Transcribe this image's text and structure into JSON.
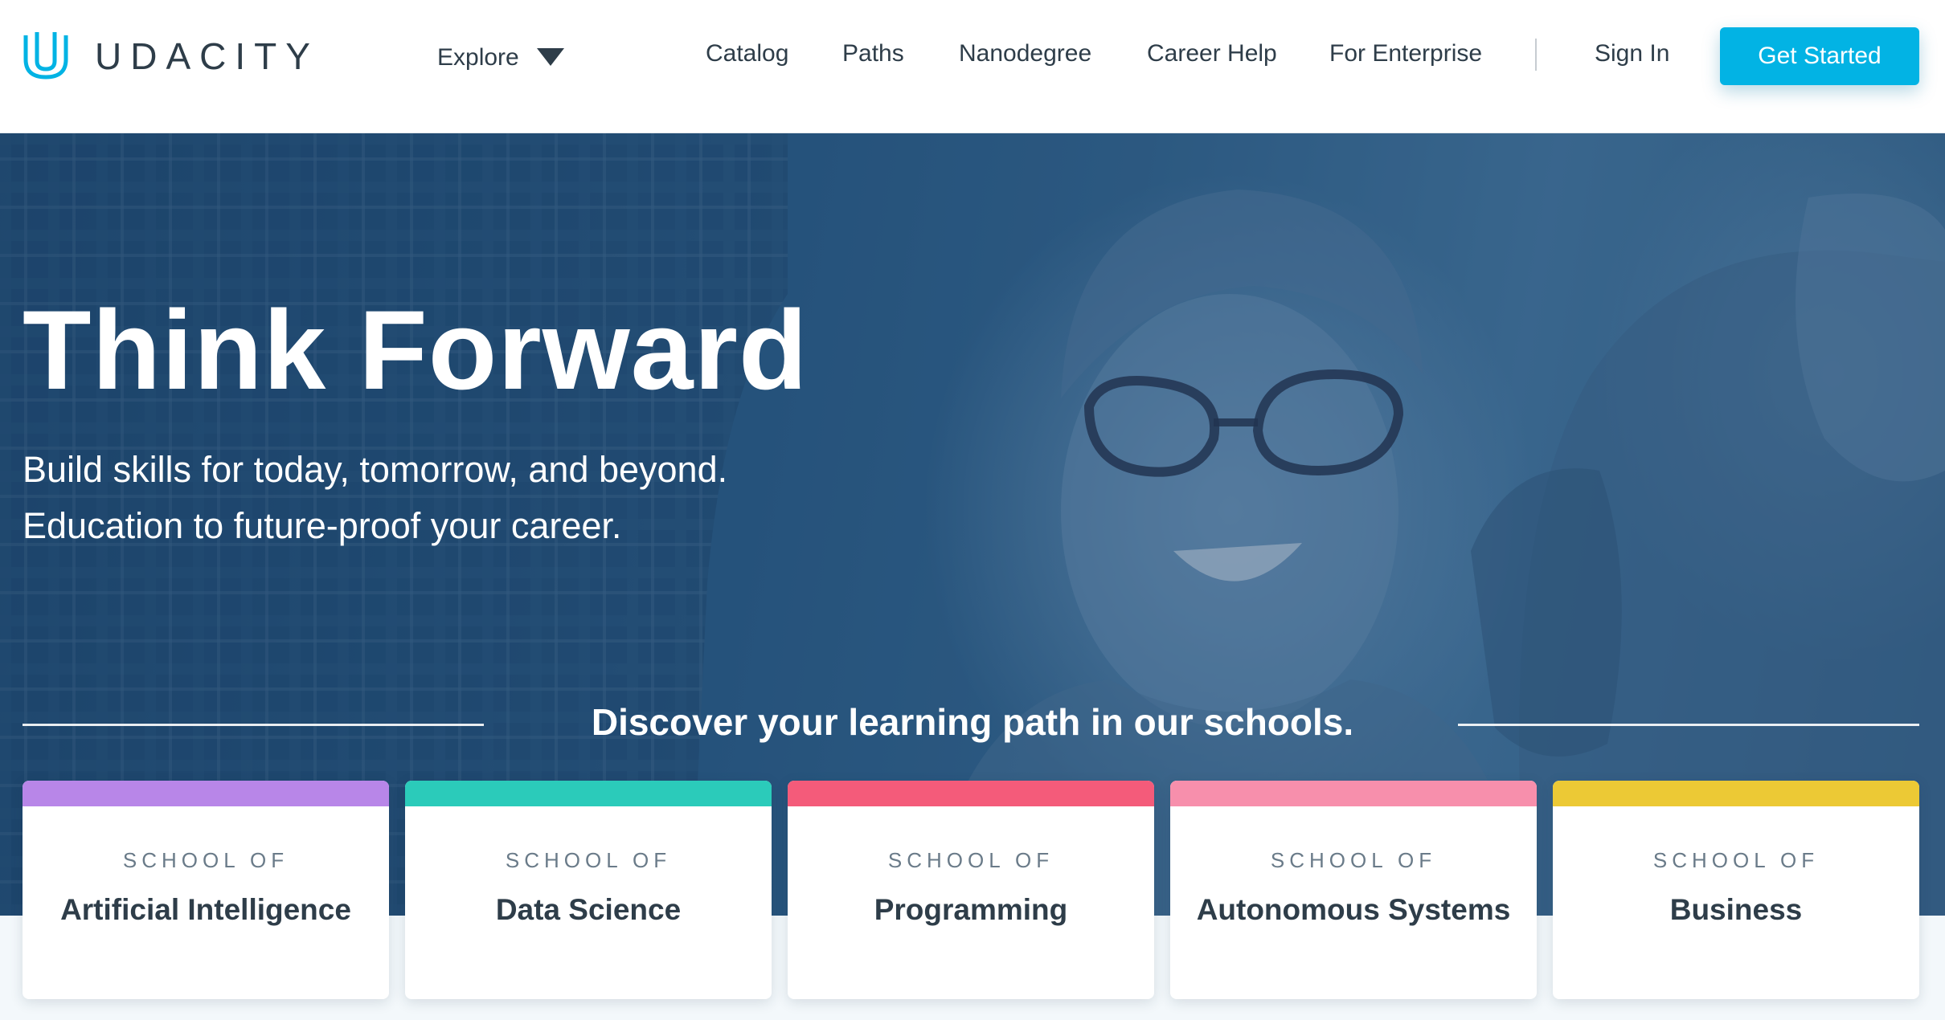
{
  "brand": {
    "name": "UDACITY",
    "accent": "#02b3e4"
  },
  "nav": {
    "explore_label": "Explore",
    "links": [
      "Catalog",
      "Paths",
      "Nanodegree",
      "Career Help",
      "For Enterprise"
    ],
    "signin_label": "Sign In",
    "cta_label": "Get Started"
  },
  "hero": {
    "headline": "Think Forward",
    "sub_line1": "Build skills for today, tomorrow, and beyond.",
    "sub_line2": "Education to future-proof your career.",
    "discover": "Discover your learning path in our schools."
  },
  "schools": [
    {
      "kicker": "SCHOOL OF",
      "title": "Artificial Intelligence",
      "color": "#b886e8"
    },
    {
      "kicker": "SCHOOL OF",
      "title": "Data Science",
      "color": "#2bcbba"
    },
    {
      "kicker": "SCHOOL OF",
      "title": "Programming",
      "color": "#f45b7a"
    },
    {
      "kicker": "SCHOOL OF",
      "title": "Autonomous Systems",
      "color": "#f78fac"
    },
    {
      "kicker": "SCHOOL OF",
      "title": "Business",
      "color": "#ecc935"
    }
  ]
}
